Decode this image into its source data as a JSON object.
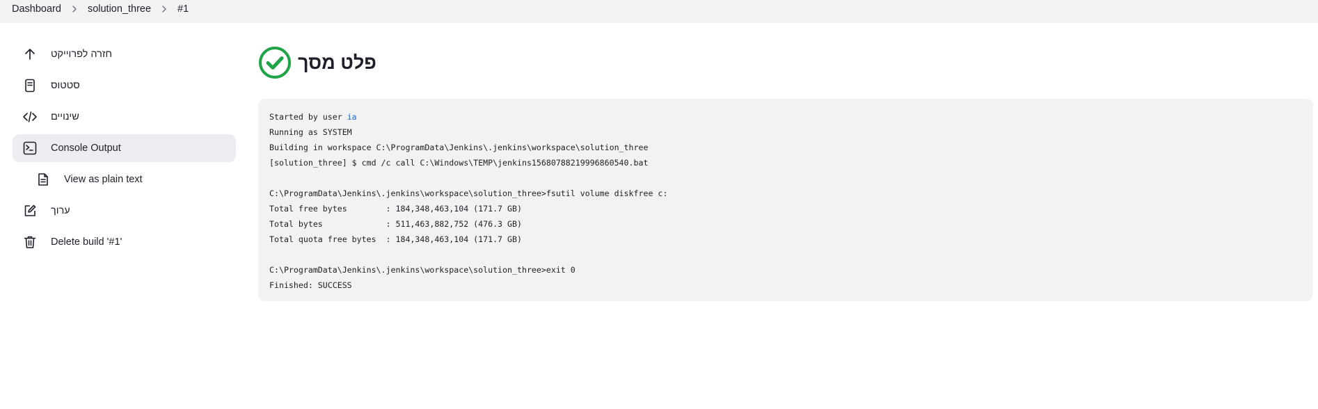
{
  "breadcrumb": {
    "items": [
      "Dashboard",
      "solution_three",
      "#1"
    ]
  },
  "sidebar": {
    "items": [
      {
        "label": "חזרה לפרוייקט",
        "icon": "arrow-up-icon"
      },
      {
        "label": "סטטוס",
        "icon": "document-icon"
      },
      {
        "label": "שינויים",
        "icon": "code-icon"
      },
      {
        "label": "Console Output",
        "icon": "terminal-icon",
        "active": true
      },
      {
        "label": "View as plain text",
        "icon": "file-text-icon"
      },
      {
        "label": "ערוך",
        "icon": "edit-icon"
      },
      {
        "label": "Delete build '#1'",
        "icon": "trash-icon"
      }
    ]
  },
  "main": {
    "title": "פלט מסך",
    "status_icon": "success-check-icon",
    "status_color": "#1ea446"
  },
  "console": {
    "prefix_started": "Started by user ",
    "user": "ia",
    "lines_after": "Running as SYSTEM\nBuilding in workspace C:\\ProgramData\\Jenkins\\.jenkins\\workspace\\solution_three\n[solution_three] $ cmd /c call C:\\Windows\\TEMP\\jenkins15680788219996860540.bat\n\nC:\\ProgramData\\Jenkins\\.jenkins\\workspace\\solution_three>fsutil volume diskfree c:\nTotal free bytes        : 184,348,463,104 (171.7 GB)\nTotal bytes             : 511,463,882,752 (476.3 GB)\nTotal quota free bytes  : 184,348,463,104 (171.7 GB)\n\nC:\\ProgramData\\Jenkins\\.jenkins\\workspace\\solution_three>exit 0\nFinished: SUCCESS"
  }
}
